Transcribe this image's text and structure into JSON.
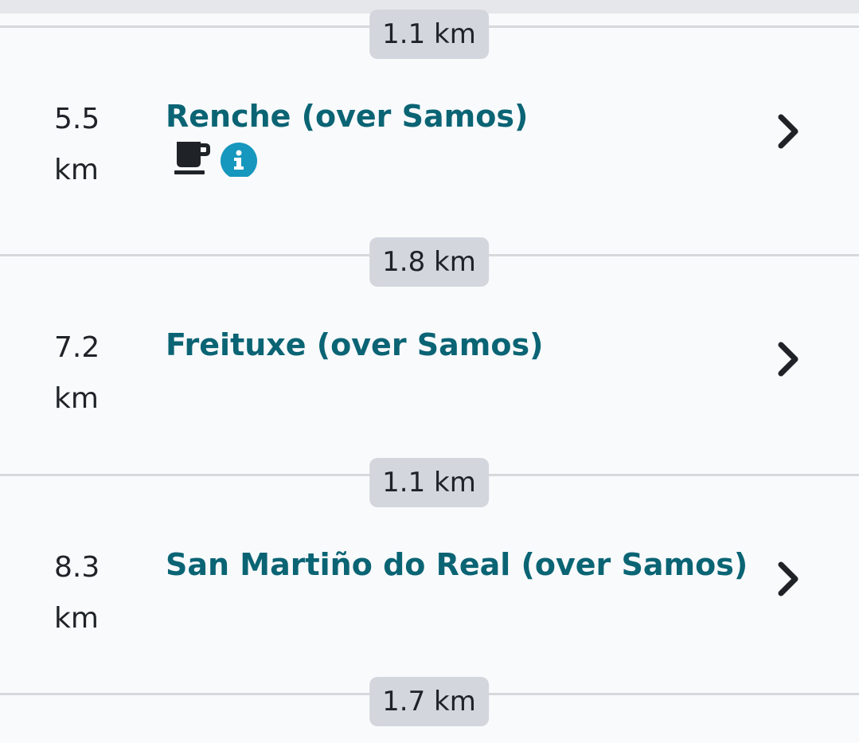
{
  "segments": [
    {
      "distance": "1.1 km"
    },
    {
      "distance": "1.8 km"
    },
    {
      "distance": "1.1 km"
    },
    {
      "distance": "1.7 km"
    }
  ],
  "stops": [
    {
      "km_number": "5.5",
      "km_unit": "km",
      "name": "Renche (over Samos)",
      "amenities": [
        "coffee-cup-icon",
        "info-icon"
      ]
    },
    {
      "km_number": "7.2",
      "km_unit": "km",
      "name": "Freituxe (over Samos)",
      "amenities": []
    },
    {
      "km_number": "8.3",
      "km_unit": "km",
      "name": "San Martiño do Real (over Samos)",
      "amenities": []
    }
  ],
  "colors": {
    "background": "#f8fafc",
    "stop_name": "#0a6474",
    "badge_bg": "#d3d6dc",
    "separator": "#d6d8dc",
    "info_icon_bg": "#1697bd",
    "text": "#1f2328"
  }
}
